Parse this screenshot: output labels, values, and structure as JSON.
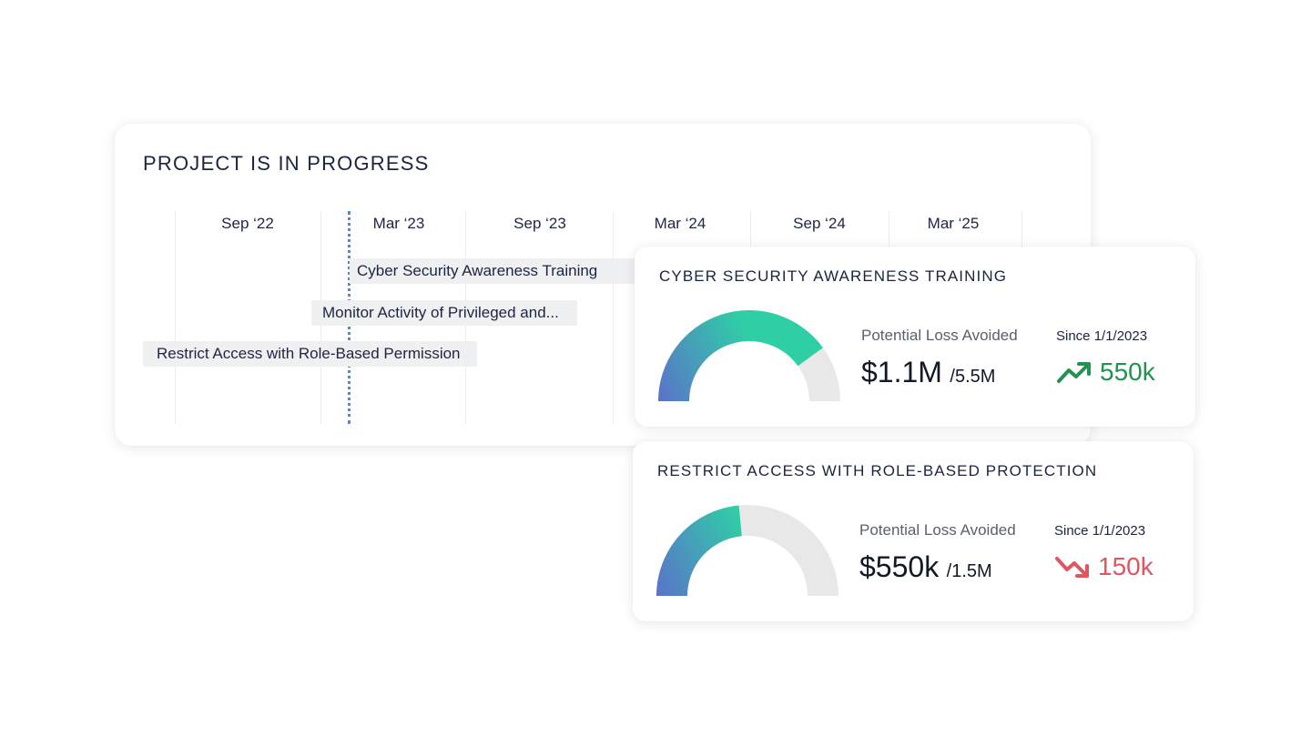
{
  "timeline": {
    "title": "PROJECT IS IN PROGRESS",
    "periods": [
      "Sep ‘22",
      "Mar ‘23",
      "Sep ‘23",
      "Mar ‘24",
      "Sep ‘24",
      "Mar ‘25"
    ],
    "tasks": [
      "Cyber Security Awareness Training",
      "Monitor Activity of Privileged and...",
      "Restrict Access with Role-Based Permission"
    ]
  },
  "cards": [
    {
      "title": "CYBER SECURITY AWARENESS TRAINING",
      "loss_label": "Potential Loss Avoided",
      "loss_value": "$1.1M",
      "loss_total": "/5.5M",
      "gauge_fraction": 0.8,
      "since_label": "Since 1/1/2023",
      "delta_value": "550k",
      "delta_direction": "up",
      "delta_icon": "trend-up-icon",
      "delta_color": "#23924f"
    },
    {
      "title": "RESTRICT ACCESS WITH ROLE-BASED PROTECTION",
      "loss_label": "Potential Loss Avoided",
      "loss_value": "$550k",
      "loss_total": "/1.5M",
      "gauge_fraction": 0.47,
      "since_label": "Since 1/1/2023",
      "delta_value": "150k",
      "delta_direction": "down",
      "delta_icon": "trend-down-icon",
      "delta_color": "#e0565e"
    }
  ],
  "colors": {
    "gauge_start": "#5b72c9",
    "gauge_end": "#2fcfa6",
    "gauge_track": "#e8e8e8",
    "today_line": "#5a86d8"
  }
}
